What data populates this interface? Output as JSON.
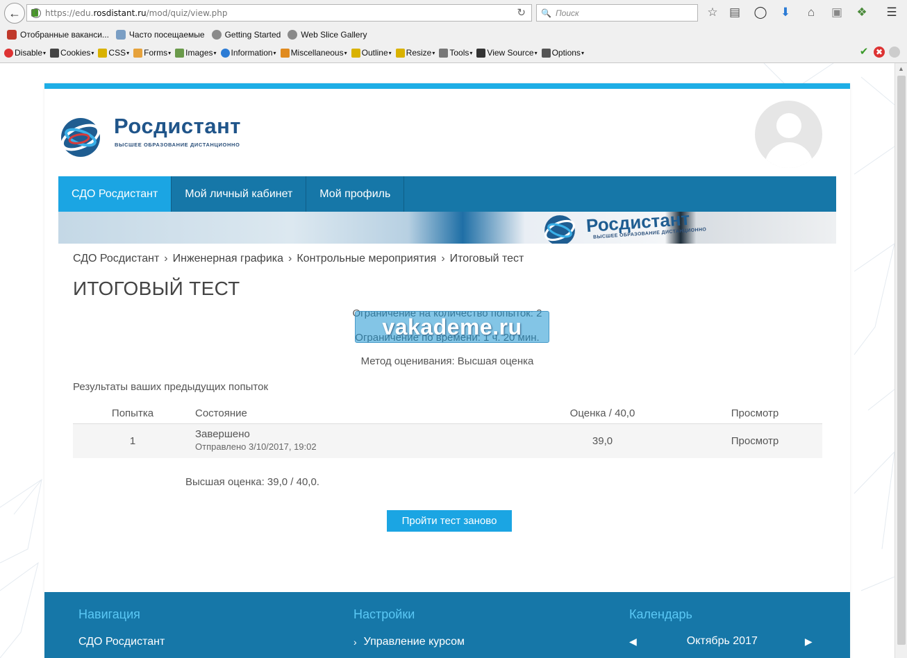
{
  "browser": {
    "url_prefix": "https://edu.",
    "url_domain": "rosdistant.ru",
    "url_path": "/mod/quiz/view.php",
    "search_placeholder": "Поиск",
    "bookmarks": [
      "Отобранные ваканси...",
      "Часто посещаемые",
      "Getting Started",
      "Web Slice Gallery"
    ],
    "devtools": [
      "Disable",
      "Cookies",
      "CSS",
      "Forms",
      "Images",
      "Information",
      "Miscellaneous",
      "Outline",
      "Resize",
      "Tools",
      "View Source",
      "Options"
    ]
  },
  "site": {
    "brand": "Росдистант",
    "tagline": "ВЫСШЕЕ ОБРАЗОВАНИЕ ДИСТАНЦИОННО",
    "nav": [
      "СДО Росдистант",
      "Мой личный кабинет",
      "Мой профиль"
    ]
  },
  "breadcrumb": [
    "СДО Росдистант",
    "Инженерная графика",
    "Контрольные мероприятия",
    "Итоговый тест"
  ],
  "quiz": {
    "title": "ИТОГОВЫЙ ТЕСТ",
    "attempts_limit": "Ограничение на количество попыток: 2",
    "time_limit": "Ограничение по времени: 1 ч. 20 мин.",
    "grading_method": "Метод оценивания: Высшая оценка",
    "previous_results": "Результаты ваших предыдущих попыток",
    "table": {
      "headers": [
        "Попытка",
        "Состояние",
        "Оценка / 40,0",
        "Просмотр"
      ],
      "rows": [
        {
          "attempt": "1",
          "state": "Завершено",
          "submitted": "Отправлено 3/10/2017, 19:02",
          "grade": "39,0",
          "review": "Просмотр"
        }
      ]
    },
    "best_grade": "Высшая оценка: 39,0 / 40,0.",
    "retry_button": "Пройти тест заново"
  },
  "watermark": "vakademe.ru",
  "footer": {
    "nav_title": "Навигация",
    "nav_item": "СДО Росдистант",
    "settings_title": "Настройки",
    "settings_item": "Управление курсом",
    "calendar_title": "Календарь",
    "calendar_month": "Октябрь 2017"
  },
  "colors": {
    "accent": "#1ba5e3",
    "nav_bg": "#1677a8",
    "footer_heading": "#5bc8f5"
  }
}
